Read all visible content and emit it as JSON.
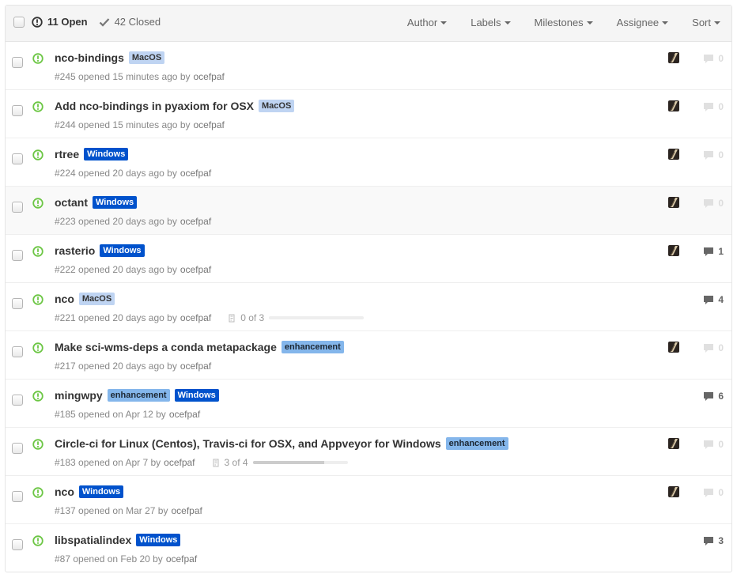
{
  "colors": {
    "open_green": "#6cc644",
    "macos_bg": "#bfd4f2",
    "macos_fg": "#333333",
    "windows_bg": "#0052cc",
    "windows_fg": "#ffffff",
    "enhancement_bg": "#84b6eb",
    "enhancement_fg": "#1c2733"
  },
  "header": {
    "open_label": "11 Open",
    "closed_label": "42 Closed",
    "filters": [
      {
        "label": "Author"
      },
      {
        "label": "Labels"
      },
      {
        "label": "Milestones"
      },
      {
        "label": "Assignee"
      },
      {
        "label": "Sort"
      }
    ]
  },
  "issues": [
    {
      "title": "nco-bindings",
      "labels": [
        {
          "text": "MacOS",
          "kind": "macos"
        }
      ],
      "number": "#245",
      "opened": "opened 15 minutes ago by",
      "author": "ocefpaf",
      "has_avatar": true,
      "comments": "0",
      "comment_state": "zero",
      "highlight": false
    },
    {
      "title": "Add nco-bindings in pyaxiom for OSX",
      "labels": [
        {
          "text": "MacOS",
          "kind": "macos"
        }
      ],
      "number": "#244",
      "opened": "opened 15 minutes ago by",
      "author": "ocefpaf",
      "has_avatar": true,
      "comments": "0",
      "comment_state": "zero",
      "highlight": false
    },
    {
      "title": "rtree",
      "labels": [
        {
          "text": "Windows",
          "kind": "windows"
        }
      ],
      "number": "#224",
      "opened": "opened 20 days ago by",
      "author": "ocefpaf",
      "has_avatar": true,
      "comments": "0",
      "comment_state": "zero",
      "highlight": false
    },
    {
      "title": "octant",
      "labels": [
        {
          "text": "Windows",
          "kind": "windows"
        }
      ],
      "number": "#223",
      "opened": "opened 20 days ago by",
      "author": "ocefpaf",
      "has_avatar": true,
      "comments": "0",
      "comment_state": "zero",
      "highlight": true
    },
    {
      "title": "rasterio",
      "labels": [
        {
          "text": "Windows",
          "kind": "windows"
        }
      ],
      "number": "#222",
      "opened": "opened 20 days ago by",
      "author": "ocefpaf",
      "has_avatar": true,
      "comments": "1",
      "comment_state": "has",
      "highlight": false
    },
    {
      "title": "nco",
      "labels": [
        {
          "text": "MacOS",
          "kind": "macos"
        }
      ],
      "number": "#221",
      "opened": "opened 20 days ago by",
      "author": "ocefpaf",
      "has_avatar": false,
      "comments": "4",
      "comment_state": "has",
      "highlight": false,
      "progress": {
        "text": "0 of 3",
        "fraction": 0
      }
    },
    {
      "title": "Make sci-wms-deps a conda metapackage",
      "labels": [
        {
          "text": "enhancement",
          "kind": "enhancement"
        }
      ],
      "number": "#217",
      "opened": "opened 20 days ago by",
      "author": "ocefpaf",
      "has_avatar": true,
      "comments": "0",
      "comment_state": "zero",
      "highlight": false
    },
    {
      "title": "mingwpy",
      "labels": [
        {
          "text": "enhancement",
          "kind": "enhancement"
        },
        {
          "text": "Windows",
          "kind": "windows"
        }
      ],
      "number": "#185",
      "opened": "opened on Apr 12 by",
      "author": "ocefpaf",
      "has_avatar": false,
      "comments": "6",
      "comment_state": "has",
      "highlight": false
    },
    {
      "title": "Circle-ci for Linux (Centos), Travis-ci for OSX, and Appveyor for Windows",
      "labels": [
        {
          "text": "enhancement",
          "kind": "enhancement"
        }
      ],
      "number": "#183",
      "opened": "opened on Apr 7 by",
      "author": "ocefpaf",
      "has_avatar": true,
      "comments": "0",
      "comment_state": "zero",
      "highlight": false,
      "progress": {
        "text": "3 of 4",
        "fraction": 0.75
      }
    },
    {
      "title": "nco",
      "labels": [
        {
          "text": "Windows",
          "kind": "windows"
        }
      ],
      "number": "#137",
      "opened": "opened on Mar 27 by",
      "author": "ocefpaf",
      "has_avatar": true,
      "comments": "0",
      "comment_state": "zero",
      "highlight": false
    },
    {
      "title": "libspatialindex",
      "labels": [
        {
          "text": "Windows",
          "kind": "windows"
        }
      ],
      "number": "#87",
      "opened": "opened on Feb 20 by",
      "author": "ocefpaf",
      "has_avatar": false,
      "comments": "3",
      "comment_state": "has",
      "highlight": false
    }
  ]
}
